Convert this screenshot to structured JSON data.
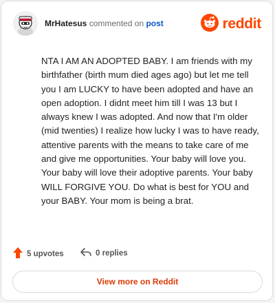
{
  "comment": {
    "author": "MrHatesus",
    "action_text": "commented on",
    "post_link_label": "post",
    "body": "NTA I AM AN ADOPTED BABY. I am friends with my birthfather (birth mum died ages ago) but let me tell you I am LUCKY to have been adopted and have an open adoption. I didnt meet him till I was 13 but I always knew I was adopted. And now that I'm older (mid twenties) I realize how lucky I was to have ready, attentive parents with the means to take care of me and give me opportunities. Your baby will love you. Your baby will love their adoptive parents. Your baby WILL FORGIVE YOU. Do what is best for YOU and your BABY. Your mom is being a brat."
  },
  "brand": {
    "wordmark": "reddit",
    "logo_icon": "reddit-snoo-icon",
    "color": "#ff4500"
  },
  "footer": {
    "upvotes_label": "5 upvotes",
    "replies_label": "0 replies",
    "upvote_icon": "upvote-arrow-icon",
    "reply_icon": "reply-arrow-icon"
  },
  "cta": {
    "view_more_label": "View more on Reddit"
  }
}
